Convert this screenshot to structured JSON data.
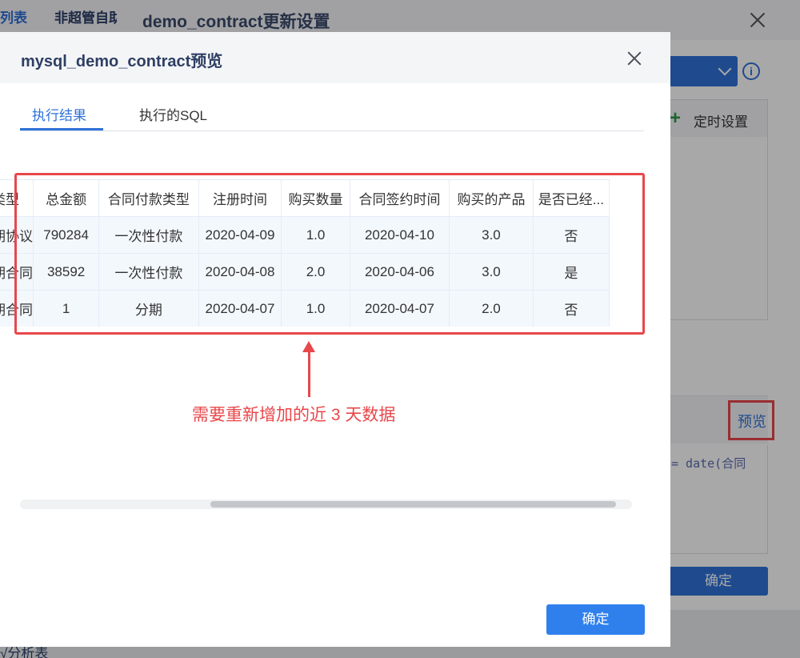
{
  "background": {
    "tabs": [
      "列表",
      "非超管自助"
    ],
    "bottom_text": "√分析表"
  },
  "update_dialog": {
    "title": "demo_contract更新设置",
    "schedule_label": "定时设置",
    "preview_label": "预览",
    "code_snippet": "= date(合同",
    "ok_label": "确定"
  },
  "preview_dialog": {
    "title": "mysql_demo_contract预览",
    "tabs": [
      {
        "label": "执行结果",
        "active": true
      },
      {
        "label": "执行的SQL",
        "active": false
      }
    ],
    "table": {
      "columns": [
        "类型",
        "总金额",
        "合同付款类型",
        "注册时间",
        "购买数量",
        "合同签约时间",
        "购买的产品",
        "是否已经..."
      ],
      "rows": [
        [
          "长期协议",
          "790284",
          "一次性付款",
          "2020-04-09",
          "1.0",
          "2020-04-10",
          "3.0",
          "否"
        ],
        [
          "短期合同",
          "38592",
          "一次性付款",
          "2020-04-08",
          "2.0",
          "2020-04-06",
          "3.0",
          "是"
        ],
        [
          "短期合同",
          "1",
          "分期",
          "2020-04-07",
          "1.0",
          "2020-04-07",
          "2.0",
          "否"
        ]
      ]
    },
    "annotation": "需要重新增加的近 3 天数据",
    "ok_label": "确定"
  },
  "colors": {
    "primary": "#2f72d8",
    "annotation_red": "#e8474b"
  }
}
